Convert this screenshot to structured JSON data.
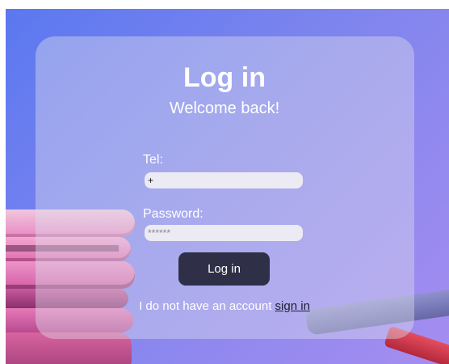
{
  "login": {
    "title": "Log in",
    "subtitle": "Welcome back!",
    "tel": {
      "label": "Tel:",
      "value": "+",
      "placeholder": ""
    },
    "password": {
      "label": "Password:",
      "value": "",
      "placeholder": "******"
    },
    "submit_label": "Log in",
    "footer": {
      "text": "I do not have an account",
      "link_label": "sign in"
    }
  },
  "colors": {
    "button_bg": "#2f3047",
    "link": "#1e1f33",
    "gradient_start": "#5b78f0",
    "gradient_end": "#a68df0"
  }
}
